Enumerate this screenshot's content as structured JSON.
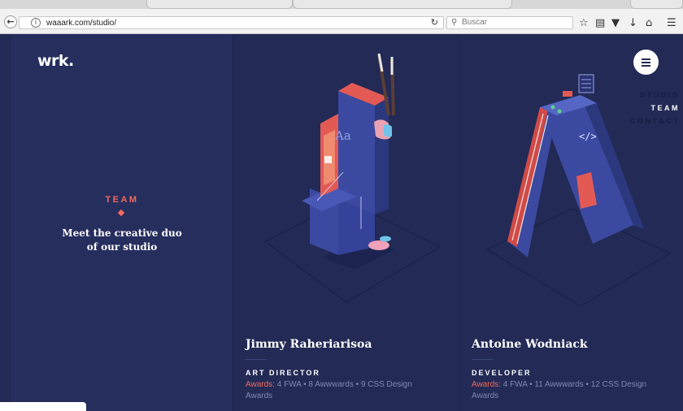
{
  "browser": {
    "url": "waaark.com/studio/",
    "search_placeholder": "Buscar",
    "back_icon": "back-arrow-icon",
    "toolbar_icons": [
      "star-icon",
      "reading-list-icon",
      "pocket-icon",
      "download-icon",
      "home-icon",
      "menu-icon"
    ]
  },
  "site": {
    "logo": "wrk.",
    "section_label": "TEAM",
    "intro": "Meet the creative duo of our studio",
    "nav": [
      "STUDIO",
      "TEAM",
      "CONTACT"
    ],
    "accent_color": "#f26a5a",
    "background_color": "#222a55"
  },
  "team": [
    {
      "name": "Jimmy Raheriarisoa",
      "role": "ART DIRECTOR",
      "awards_label": "Awards:",
      "awards_text": " 4 FWA • 8 Awwwards • 9 CSS Design Awards",
      "letter": "J",
      "letter_caption": "Aa"
    },
    {
      "name": "Antoine Wodniack",
      "role": "DEVELOPER",
      "awards_label": "Awards:",
      "awards_text": " 4 FWA • 11 Awwwards • 12 CSS Design Awards",
      "letter": "A",
      "letter_caption": "</>"
    }
  ]
}
